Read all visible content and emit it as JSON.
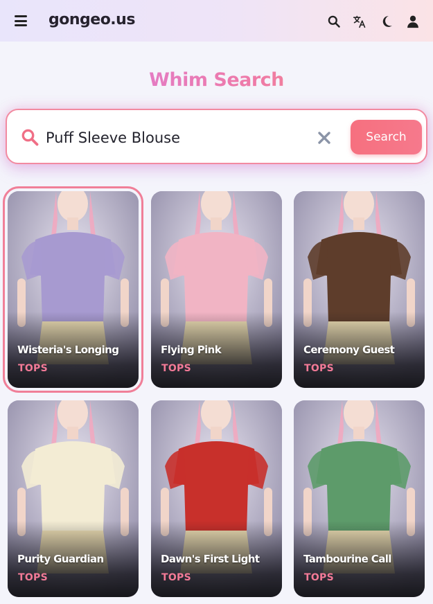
{
  "header": {
    "brand": "gongeo.us",
    "icons": [
      "menu-icon",
      "search-icon",
      "translate-icon",
      "moon-icon",
      "user-icon"
    ]
  },
  "page": {
    "title": "Whim Search"
  },
  "search": {
    "value": "Puff Sleeve Blouse",
    "button_label": "Search"
  },
  "colors": {
    "accent": "#f6707f",
    "category_text": "#f37a97",
    "title_gradient": [
      "#d67de8",
      "#ef7aa6",
      "#f49b6e"
    ],
    "selected_outline": "#f07f98"
  },
  "results": [
    {
      "name": "Wisteria's Longing",
      "category": "TOPS",
      "selected": true,
      "outfit_color": "#a79ad0"
    },
    {
      "name": "Flying Pink",
      "category": "TOPS",
      "selected": false,
      "outfit_color": "#f1b4c4"
    },
    {
      "name": "Ceremony Guest",
      "category": "TOPS",
      "selected": false,
      "outfit_color": "#5e3d2b"
    },
    {
      "name": "Purity Guardian",
      "category": "TOPS",
      "selected": false,
      "outfit_color": "#f3ecd4"
    },
    {
      "name": "Dawn's First Light",
      "category": "TOPS",
      "selected": false,
      "outfit_color": "#c8302b"
    },
    {
      "name": "Tambourine Call",
      "category": "TOPS",
      "selected": false,
      "outfit_color": "#5d9b6a"
    }
  ]
}
